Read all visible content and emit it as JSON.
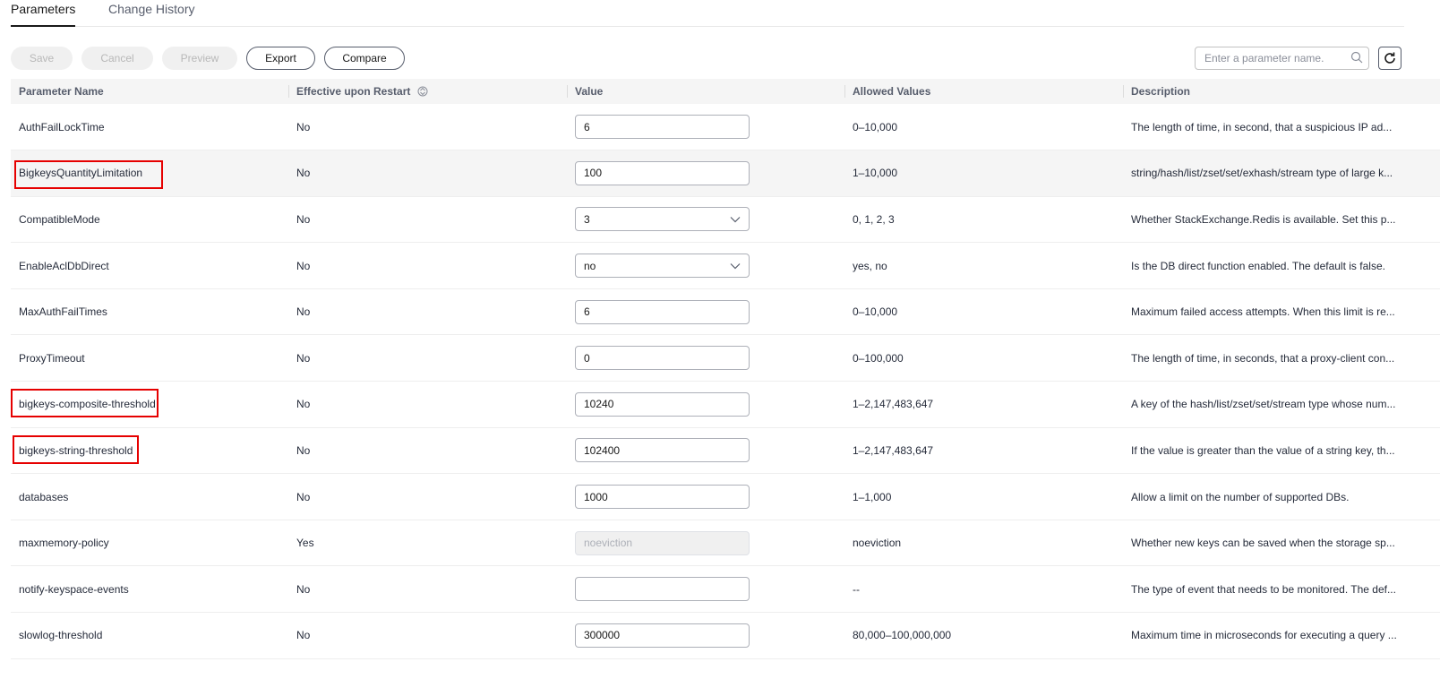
{
  "tabs": [
    {
      "label": "Parameters",
      "active": true
    },
    {
      "label": "Change History",
      "active": false
    }
  ],
  "toolbar": {
    "save": "Save",
    "cancel": "Cancel",
    "preview": "Preview",
    "export": "Export",
    "compare": "Compare",
    "search_placeholder": "Enter a parameter name."
  },
  "columns": [
    "Parameter Name",
    "Effective upon Restart",
    "Value",
    "Allowed Values",
    "Description"
  ],
  "highlight_color": "#e60000",
  "rows": [
    {
      "name": "AuthFailLockTime",
      "restart": "No",
      "value": "6",
      "type": "text",
      "allowed": "0–10,000",
      "desc": "The length of time, in second, that a suspicious IP ad..."
    },
    {
      "name": "BigkeysQuantityLimitation",
      "restart": "No",
      "value": "100",
      "type": "text",
      "allowed": "1–10,000",
      "desc": "string/hash/list/zset/set/exhash/stream type of large k..."
    },
    {
      "name": "CompatibleMode",
      "restart": "No",
      "value": "3",
      "type": "select",
      "allowed": "0, 1, 2, 3",
      "desc": "Whether StackExchange.Redis is available. Set this p..."
    },
    {
      "name": "EnableAclDbDirect",
      "restart": "No",
      "value": "no",
      "type": "select",
      "allowed": "yes, no",
      "desc": "Is the DB direct function enabled. The default is false."
    },
    {
      "name": "MaxAuthFailTimes",
      "restart": "No",
      "value": "6",
      "type": "text",
      "allowed": "0–10,000",
      "desc": "Maximum failed access attempts. When this limit is re..."
    },
    {
      "name": "ProxyTimeout",
      "restart": "No",
      "value": "0",
      "type": "text",
      "allowed": "0–100,000",
      "desc": "The length of time, in seconds, that a proxy-client con..."
    },
    {
      "name": "bigkeys-composite-threshold",
      "restart": "No",
      "value": "10240",
      "type": "text",
      "allowed": "1–2,147,483,647",
      "desc": "A key of the hash/list/zset/set/stream type whose num..."
    },
    {
      "name": "bigkeys-string-threshold",
      "restart": "No",
      "value": "102400",
      "type": "text",
      "allowed": "1–2,147,483,647",
      "desc": "If the value is greater than the value of a string key, th..."
    },
    {
      "name": "databases",
      "restart": "No",
      "value": "1000",
      "type": "text",
      "allowed": "1–1,000",
      "desc": "Allow a limit on the number of supported DBs."
    },
    {
      "name": "maxmemory-policy",
      "restart": "Yes",
      "value": "noeviction",
      "type": "disabled",
      "allowed": "noeviction",
      "desc": "Whether new keys can be saved when the storage sp..."
    },
    {
      "name": "notify-keyspace-events",
      "restart": "No",
      "value": "",
      "type": "text",
      "allowed": "--",
      "desc": "The type of event that needs to be monitored. The def..."
    },
    {
      "name": "slowlog-threshold",
      "restart": "No",
      "value": "300000",
      "type": "text",
      "allowed": "80,000–100,000,000",
      "desc": "Maximum time in microseconds for executing a query ..."
    }
  ]
}
